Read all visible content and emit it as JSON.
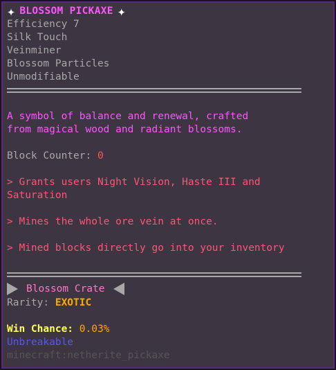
{
  "tooltip": {
    "title": "BLOSSOM PICKAXE",
    "enchantments": [
      "Efficiency 7",
      "Silk Touch",
      "Veinminer",
      "Blossom Particles",
      "Unmodifiable"
    ],
    "description": [
      "A symbol of balance and renewal, crafted",
      "from magical wood and radiant blossoms."
    ],
    "block_counter_label": "Block Counter: ",
    "block_counter_value": "0",
    "perk_1_line_1": "> Grants users Night Vision, Haste III and",
    "perk_1_line_2": "Saturation",
    "perk_2": "> Mines the whole ore vein at once.",
    "perk_3": "> Mined blocks directly go into your inventory",
    "crate_name": "Blossom Crate",
    "rarity_label": "Rarity: ",
    "rarity_value": "EXOTIC",
    "win_chance_label": "Win Chance: ",
    "win_chance_value": "0.03%",
    "unbreakable": "Unbreakable",
    "item_id": "minecraft:netherite_pickaxe"
  },
  "colors": {
    "title": "#ff55ff",
    "gray": "#a8a8a8",
    "description": "#ff55ff",
    "perk": "#ff5577",
    "rarity": "#ffaa00",
    "win_chance_label": "#ffff55",
    "unbreakable": "#5555ff",
    "item_id": "#555555",
    "background": "#3d3541",
    "border": "#5a2a7a"
  },
  "icons": {
    "title_sparkle": "sparkle-icon",
    "crate_left": "triangle-right-icon",
    "crate_right": "triangle-left-icon"
  }
}
